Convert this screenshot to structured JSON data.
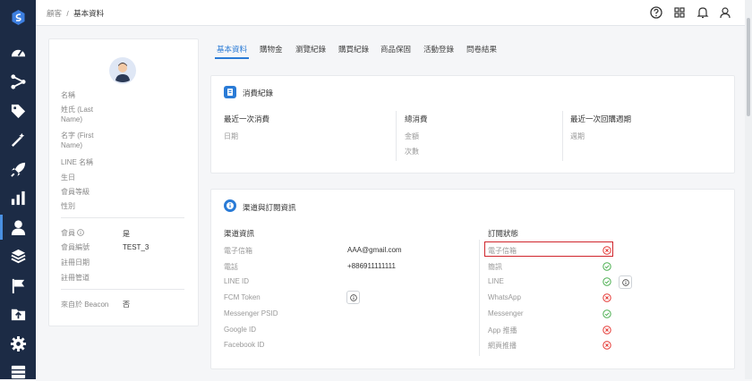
{
  "breadcrumb": {
    "root": "顧客",
    "separator": "/",
    "current": "基本資料"
  },
  "sidebar": {
    "icons": [
      "dashboard-icon",
      "flow-icon",
      "tag-icon",
      "magic-wand-icon",
      "rocket-icon",
      "bar-chart-icon",
      "user-icon",
      "box-icon",
      "flag-icon",
      "upload-icon",
      "settings-icon",
      "table-icon"
    ],
    "active_index": 6
  },
  "topbar": {
    "icons": [
      "help-icon",
      "apps-grid-icon",
      "bell-icon",
      "account-icon"
    ]
  },
  "profile": {
    "fields": [
      {
        "label": "名稱"
      },
      {
        "label": "姓氏 (Last Name)"
      },
      {
        "label": "名字 (First Name)"
      },
      {
        "label": "LINE 名稱"
      },
      {
        "label": "生日"
      },
      {
        "label": "會員等級"
      },
      {
        "label": "性別"
      }
    ],
    "member": {
      "label": "會員",
      "value": "是"
    },
    "member_id": {
      "label": "會員編號",
      "value": "TEST_3"
    },
    "reg_date": {
      "label": "註冊日期"
    },
    "reg_channel": {
      "label": "註冊管道"
    },
    "beacon": {
      "label": "來自於 Beacon",
      "value": "否"
    }
  },
  "tabs": [
    "基本資料",
    "購物金",
    "瀏覽紀錄",
    "購買紀錄",
    "商品保固",
    "活動登錄",
    "問卷結果"
  ],
  "active_tab": "基本資料",
  "consumption": {
    "title": "消費紀錄",
    "col1": {
      "head": "最近一次消費",
      "items": [
        "日期"
      ]
    },
    "col2": {
      "head": "總消費",
      "items": [
        "金額",
        "次數"
      ]
    },
    "col3": {
      "head": "最近一次回購週期",
      "items": [
        "週期"
      ]
    }
  },
  "channels": {
    "title": "渠道與訂閱資訊",
    "left_head": "渠道資訊",
    "right_head": "訂閱狀態",
    "rows": [
      {
        "label": "電子信箱",
        "value": "AAA@gmail.com"
      },
      {
        "label": "電話",
        "value": "+886911111111"
      },
      {
        "label": "LINE ID",
        "value": ""
      },
      {
        "label": "FCM Token",
        "value": ""
      },
      {
        "label": "Messenger PSID",
        "value": ""
      },
      {
        "label": "Google ID",
        "value": ""
      },
      {
        "label": "Facebook ID",
        "value": ""
      }
    ],
    "subscriptions": [
      {
        "label": "電子信箱",
        "status": "no"
      },
      {
        "label": "簡訊",
        "status": "yes"
      },
      {
        "label": "LINE",
        "status": "yes"
      },
      {
        "label": "WhatsApp",
        "status": "no"
      },
      {
        "label": "Messenger",
        "status": "yes"
      },
      {
        "label": "App 推播",
        "status": "no"
      },
      {
        "label": "網頁推播",
        "status": "no"
      }
    ]
  },
  "colors": {
    "sidebar": "#1c2b45",
    "accent": "#2a7bd6",
    "ok": "#4caf50",
    "error": "#e53935"
  }
}
